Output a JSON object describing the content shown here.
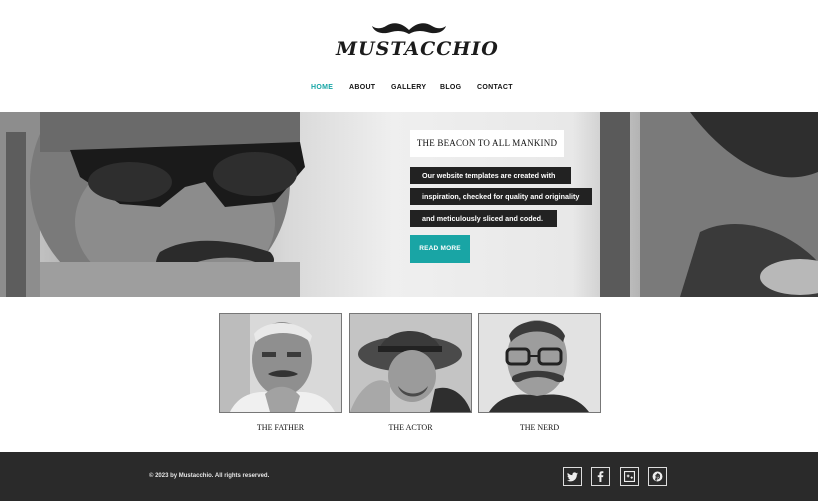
{
  "brand": {
    "name": "MUSTACCHIO"
  },
  "nav": {
    "items": [
      "HOME",
      "ABOUT",
      "GALLERY",
      "BLOG",
      "CONTACT"
    ],
    "active": "HOME"
  },
  "hero": {
    "title": "THE BEACON TO ALL MANKIND",
    "lines": [
      "Our website templates are created with",
      "inspiration, checked for quality and originality",
      "and meticulously sliced and coded."
    ],
    "cta": "READ MORE"
  },
  "cards": [
    {
      "caption": "THE FATHER"
    },
    {
      "caption": "THE ACTOR"
    },
    {
      "caption": "THE NERD"
    }
  ],
  "footer": {
    "copyright": "© 2023 by Mustacchio. All rights reserved.",
    "social": [
      "twitter-icon",
      "facebook-icon",
      "google-plus-icon",
      "pinterest-icon"
    ]
  },
  "colors": {
    "accent": "#19a5a5",
    "footer_bg": "#2a2a2a",
    "label_bg": "#222222"
  }
}
